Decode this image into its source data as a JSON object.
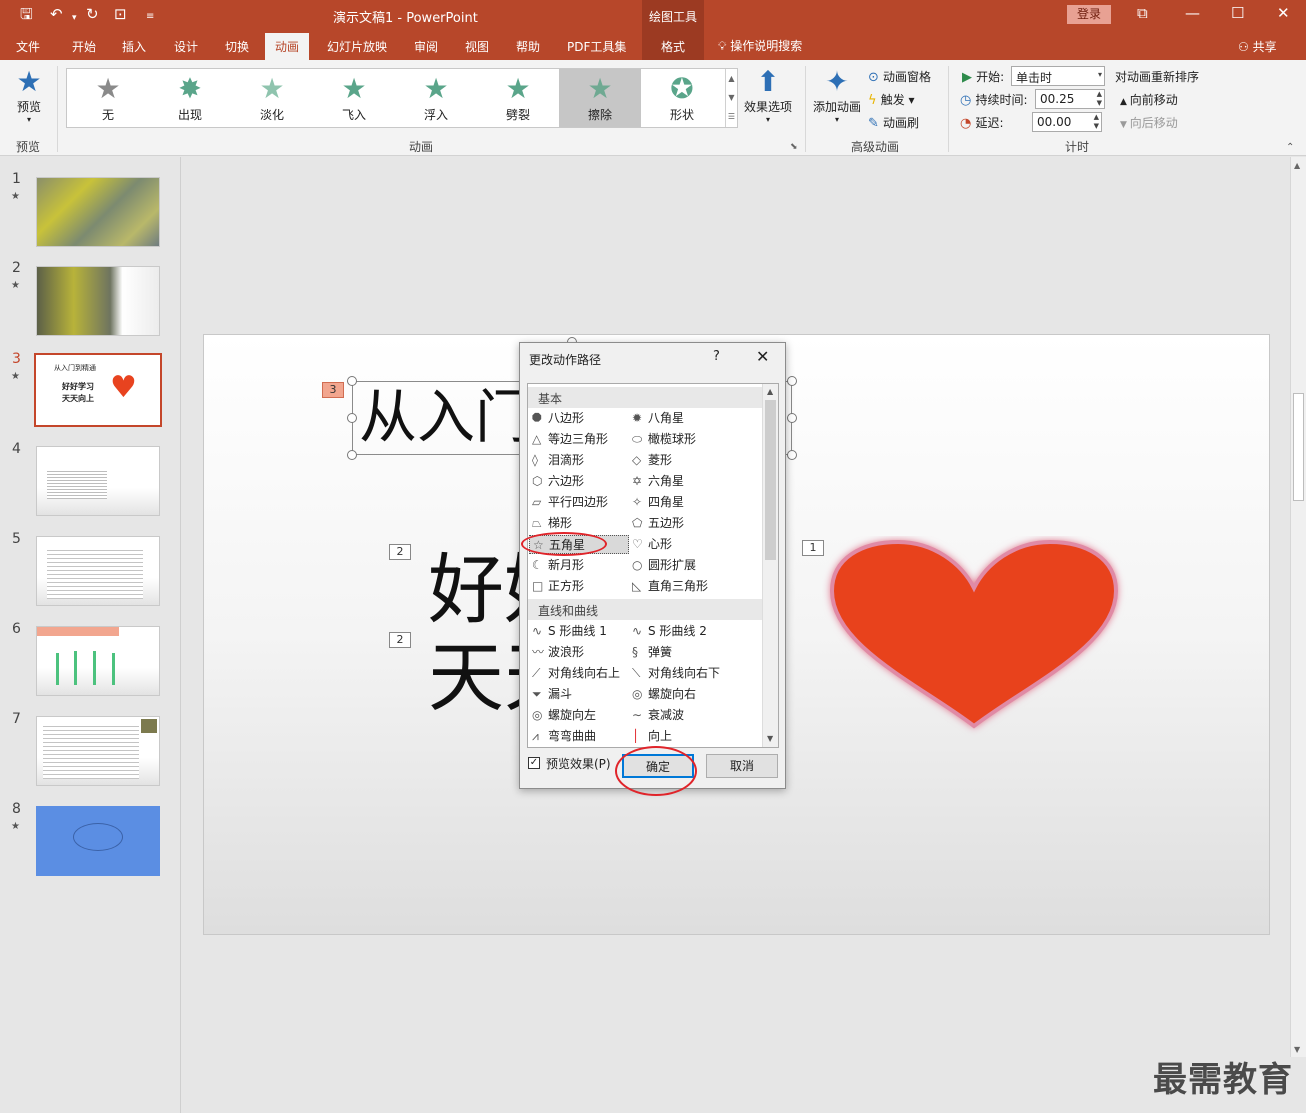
{
  "titlebar": {
    "doc_title": "演示文稿1  -  PowerPoint",
    "tools_tab": "绘图工具",
    "login": "登录"
  },
  "tabs": [
    "文件",
    "开始",
    "插入",
    "设计",
    "切换",
    "动画",
    "幻灯片放映",
    "审阅",
    "视图",
    "帮助",
    "PDF工具集"
  ],
  "format_tab": "格式",
  "search": "操作说明搜索",
  "share": "共享",
  "ribbon": {
    "preview": {
      "label": "预览",
      "group": "预览"
    },
    "gallery": [
      "无",
      "出现",
      "淡化",
      "飞入",
      "浮入",
      "劈裂",
      "擦除",
      "形状"
    ],
    "gallery_selected": "擦除",
    "effect_options": "效果选项",
    "group_animation": "动画",
    "add_animation": "添加动画",
    "anim_pane": "动画窗格",
    "trigger": "触发",
    "anim_painter": "动画刷",
    "group_advanced": "高级动画",
    "start_label": "开始:",
    "start_value": "单击时",
    "duration_label": "持续时间:",
    "duration_value": "00.25",
    "delay_label": "延迟:",
    "delay_value": "00.00",
    "group_timing": "计时",
    "reorder": "对动画重新排序",
    "move_earlier": "向前移动",
    "move_later": "向后移动"
  },
  "slides": [
    {
      "num": "1",
      "star": "★"
    },
    {
      "num": "2",
      "star": "★"
    },
    {
      "num": "3",
      "star": "★",
      "line1": "从入门到精通",
      "line2": "好好学习",
      "line3": "天天向上"
    },
    {
      "num": "4",
      "star": ""
    },
    {
      "num": "5",
      "star": ""
    },
    {
      "num": "6",
      "star": ""
    },
    {
      "num": "7",
      "star": ""
    },
    {
      "num": "8",
      "star": "★"
    }
  ],
  "slide": {
    "title": "从入门",
    "body1": "好好",
    "body2": "天天",
    "tags": [
      "3",
      "2",
      "2",
      "1"
    ],
    "heart_color": "#e8431f"
  },
  "dialog": {
    "title": "更改动作路径",
    "help": "?",
    "close": "✕",
    "section_basic": "基本",
    "basic_items": [
      [
        "八边形",
        "八角星"
      ],
      [
        "等边三角形",
        "橄榄球形"
      ],
      [
        "泪滴形",
        "菱形"
      ],
      [
        "六边形",
        "六角星"
      ],
      [
        "平行四边形",
        "四角星"
      ],
      [
        "梯形",
        "五边形"
      ],
      [
        "五角星",
        "心形"
      ],
      [
        "新月形",
        "圆形扩展"
      ],
      [
        "正方形",
        "直角三角形"
      ]
    ],
    "selected": "五角星",
    "section_lines": "直线和曲线",
    "line_items": [
      [
        "S 形曲线 1",
        "S 形曲线 2"
      ],
      [
        "波浪形",
        "弹簧"
      ],
      [
        "对角线向右上",
        "对角线向右下"
      ],
      [
        "漏斗",
        "螺旋向右"
      ],
      [
        "螺旋向左",
        "衰减波"
      ],
      [
        "弯弯曲曲",
        "向上"
      ]
    ],
    "preview_label": "预览效果(P)",
    "ok": "确定",
    "cancel": "取消"
  },
  "watermark": "最需教育",
  "colors": {
    "accent": "#b7472a",
    "highlight_ellipse": "#e0242a"
  }
}
